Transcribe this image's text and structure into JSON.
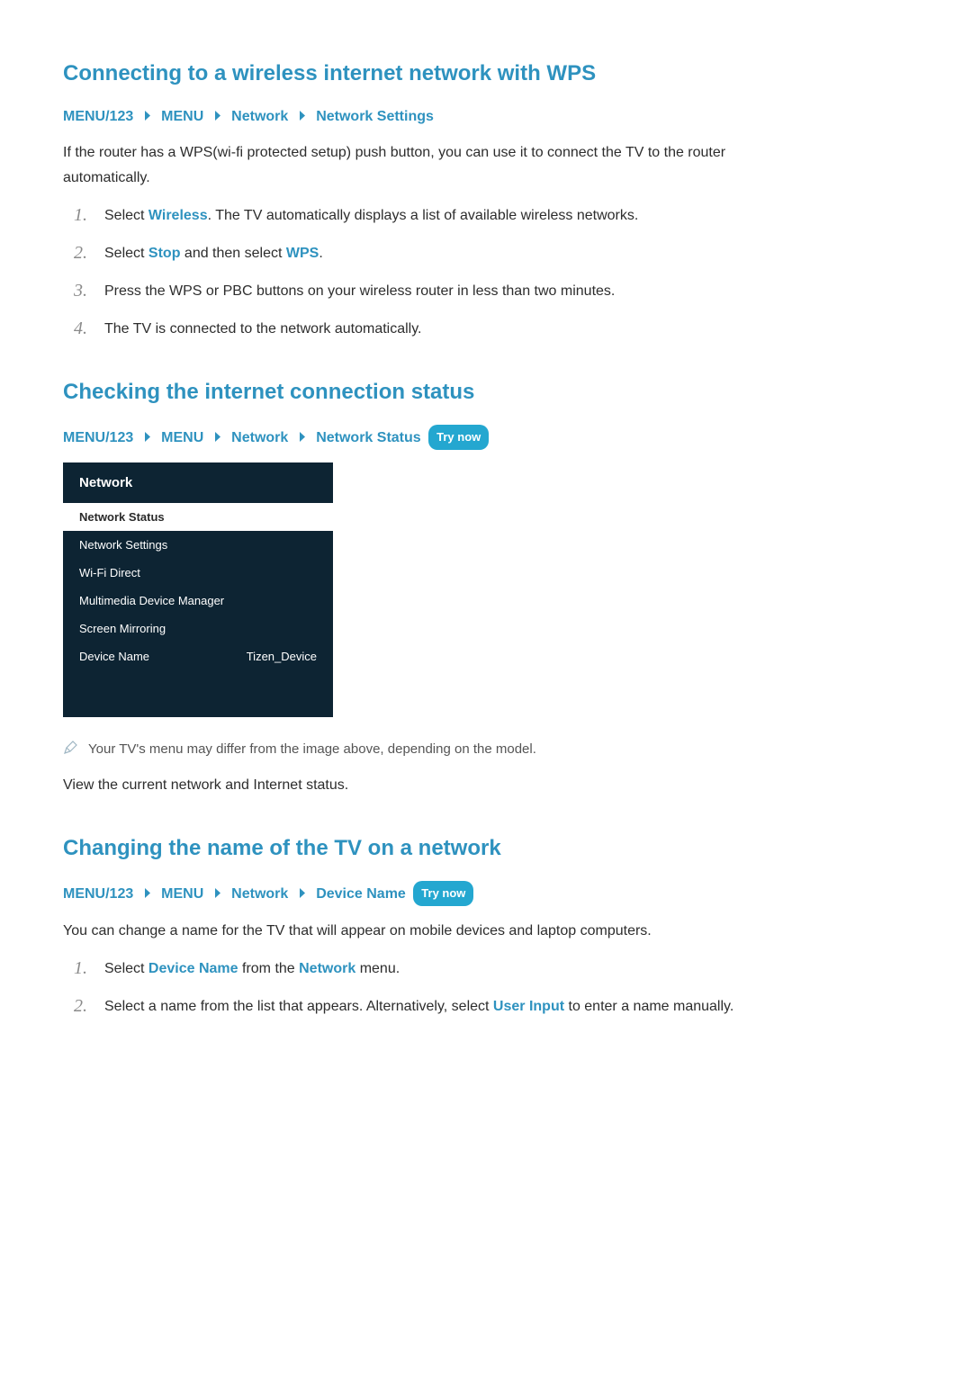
{
  "wps": {
    "heading": "Connecting to a wireless internet network with WPS",
    "crumbs": [
      "MENU/123",
      "MENU",
      "Network",
      "Network Settings"
    ],
    "intro": "If the router has a WPS(wi-fi protected setup) push button, you can use it to connect the TV to the router automatically.",
    "steps": {
      "s1a": "Select ",
      "s1b": "Wireless",
      "s1c": ". The TV automatically displays a list of available wireless networks.",
      "s2a": "Select ",
      "s2b": "Stop",
      "s2c": " and then select ",
      "s2d": "WPS",
      "s2e": ".",
      "s3": "Press the WPS or PBC buttons on your wireless router in less than two minutes.",
      "s4": "The TV is connected to the network automatically."
    }
  },
  "status": {
    "heading": "Checking the internet connection status",
    "crumbs": [
      "MENU/123",
      "MENU",
      "Network",
      "Network Status"
    ],
    "try_now": "Try now",
    "panel": {
      "title": "Network",
      "items": [
        {
          "label": "Network Status",
          "value": "",
          "selected": true
        },
        {
          "label": "Network Settings",
          "value": ""
        },
        {
          "label": "Wi-Fi Direct",
          "value": ""
        },
        {
          "label": "Multimedia Device Manager",
          "value": ""
        },
        {
          "label": "Screen Mirroring",
          "value": ""
        },
        {
          "label": "Device Name",
          "value": "Tizen_Device"
        }
      ]
    },
    "note": "Your TV's menu may differ from the image above, depending on the model.",
    "para": "View the current network and Internet status."
  },
  "rename": {
    "heading": "Changing the name of the TV on a network",
    "crumbs": [
      "MENU/123",
      "MENU",
      "Network",
      "Device Name"
    ],
    "try_now": "Try now",
    "intro": "You can change a name for the TV that will appear on mobile devices and laptop computers.",
    "steps": {
      "s1a": "Select ",
      "s1b": "Device Name",
      "s1c": " from the ",
      "s1d": "Network",
      "s1e": " menu.",
      "s2a": "Select a name from the list that appears. Alternatively, select ",
      "s2b": "User Input",
      "s2c": " to enter a name manually."
    }
  }
}
